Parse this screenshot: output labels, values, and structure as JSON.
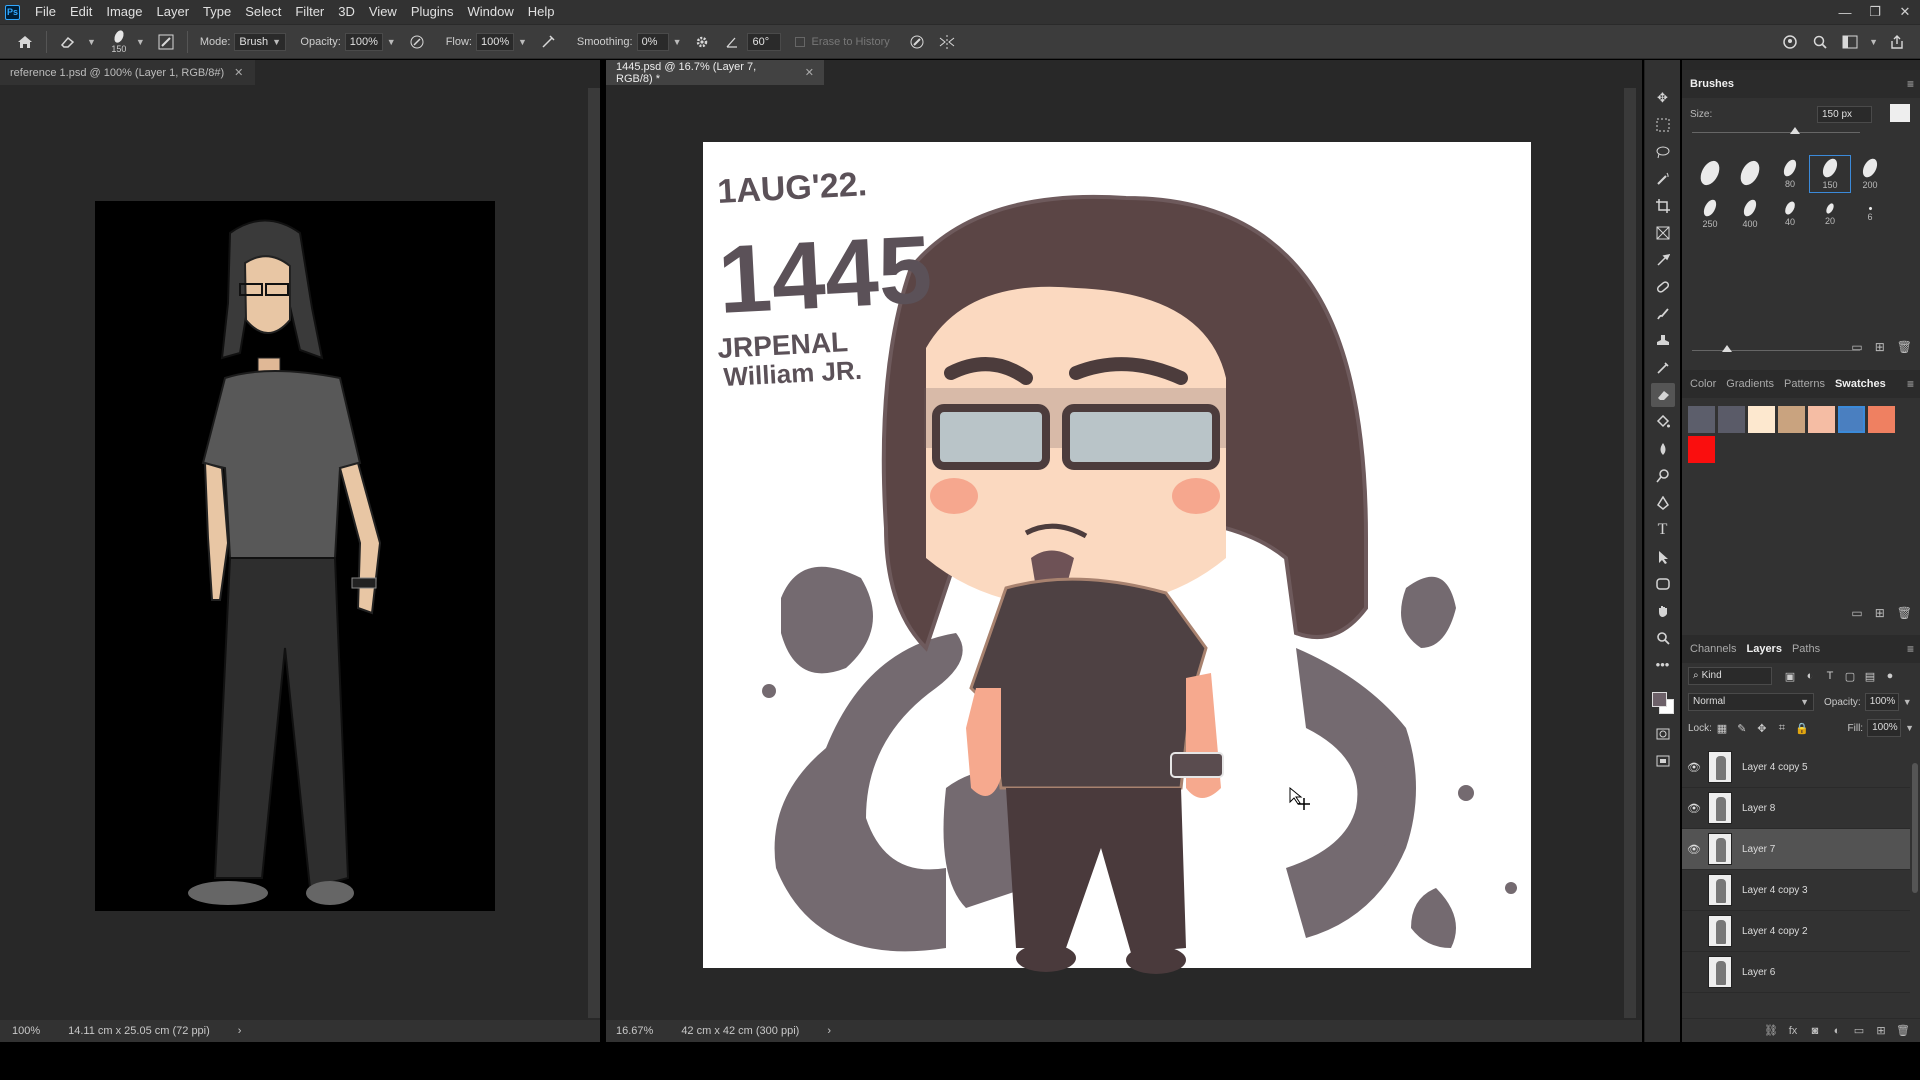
{
  "app": {
    "logo": "Ps",
    "menu": [
      "File",
      "Edit",
      "Image",
      "Layer",
      "Type",
      "Select",
      "Filter",
      "3D",
      "View",
      "Plugins",
      "Window",
      "Help"
    ]
  },
  "window_controls": {
    "minimize": "—",
    "restore": "❐",
    "close": "✕"
  },
  "options": {
    "brush_size": "150",
    "mode_label": "Mode:",
    "mode_value": "Brush",
    "opacity_label": "Opacity:",
    "opacity_value": "100%",
    "flow_label": "Flow:",
    "flow_value": "100%",
    "smoothing_label": "Smoothing:",
    "smoothing_value": "0%",
    "angle_value": "60°",
    "erase_history": "Erase to History"
  },
  "documents": {
    "left": {
      "tab": "reference 1.psd @ 100% (Layer 1, RGB/8#)",
      "zoom": "100%",
      "info": "14.11 cm x 25.05 cm (72 ppi)"
    },
    "right": {
      "tab": "1445.psd @ 16.7% (Layer 7, RGB/8) *",
      "zoom": "16.67%",
      "info": "42 cm x 42 cm (300 ppi)",
      "artwork_text": {
        "date": "1AUG'22.",
        "number": "1445",
        "caption_1": "JRPENAL",
        "caption_2": "William JR."
      }
    }
  },
  "brushes_panel": {
    "title": "Brushes",
    "size_label": "Size:",
    "size_value": "150 px",
    "presets": [
      {
        "label": "",
        "w": 16,
        "h": 26
      },
      {
        "label": "",
        "w": 16,
        "h": 26
      },
      {
        "label": "80",
        "w": 10,
        "h": 18
      },
      {
        "label": "150",
        "w": 12,
        "h": 20,
        "selected": true
      },
      {
        "label": "200",
        "w": 12,
        "h": 20
      },
      {
        "label": "250",
        "w": 10,
        "h": 18
      },
      {
        "label": "400",
        "w": 10,
        "h": 18
      },
      {
        "label": "40",
        "w": 8,
        "h": 14
      },
      {
        "label": "20",
        "w": 6,
        "h": 11
      },
      {
        "label": "6",
        "w": 3,
        "h": 3
      }
    ]
  },
  "color_panel": {
    "tabs": [
      "Color",
      "Gradients",
      "Patterns",
      "Swatches"
    ],
    "active_tab": "Swatches",
    "swatches": [
      "#5c5e6b",
      "#5a5b68",
      "#fde8cf",
      "#c9a37f",
      "#f5bda4",
      "#4a7fc0",
      "#ef8061",
      "#fa0e0e"
    ],
    "selected_index": 5
  },
  "layers_panel": {
    "tabs": [
      "Channels",
      "Layers",
      "Paths"
    ],
    "active_tab": "Layers",
    "kind": "Kind",
    "blend_mode": "Normal",
    "opacity_label": "Opacity:",
    "opacity_value": "100%",
    "lock_label": "Lock:",
    "fill_label": "Fill:",
    "fill_value": "100%",
    "layers": [
      {
        "name": "Layer 4 copy 5",
        "visible": true
      },
      {
        "name": "Layer 8",
        "visible": true
      },
      {
        "name": "Layer 7",
        "visible": true,
        "selected": true
      },
      {
        "name": "Layer 4 copy 3",
        "visible": false
      },
      {
        "name": "Layer 4 copy 2",
        "visible": false
      },
      {
        "name": "Layer 6",
        "visible": false
      }
    ]
  },
  "colors": {
    "menubar": "#323232",
    "optionsbar": "#3c3c3c",
    "canvas_bg": "#282828",
    "accent": "#3b8ad9",
    "foreground": "#6d6169",
    "background": "#ffffff"
  }
}
